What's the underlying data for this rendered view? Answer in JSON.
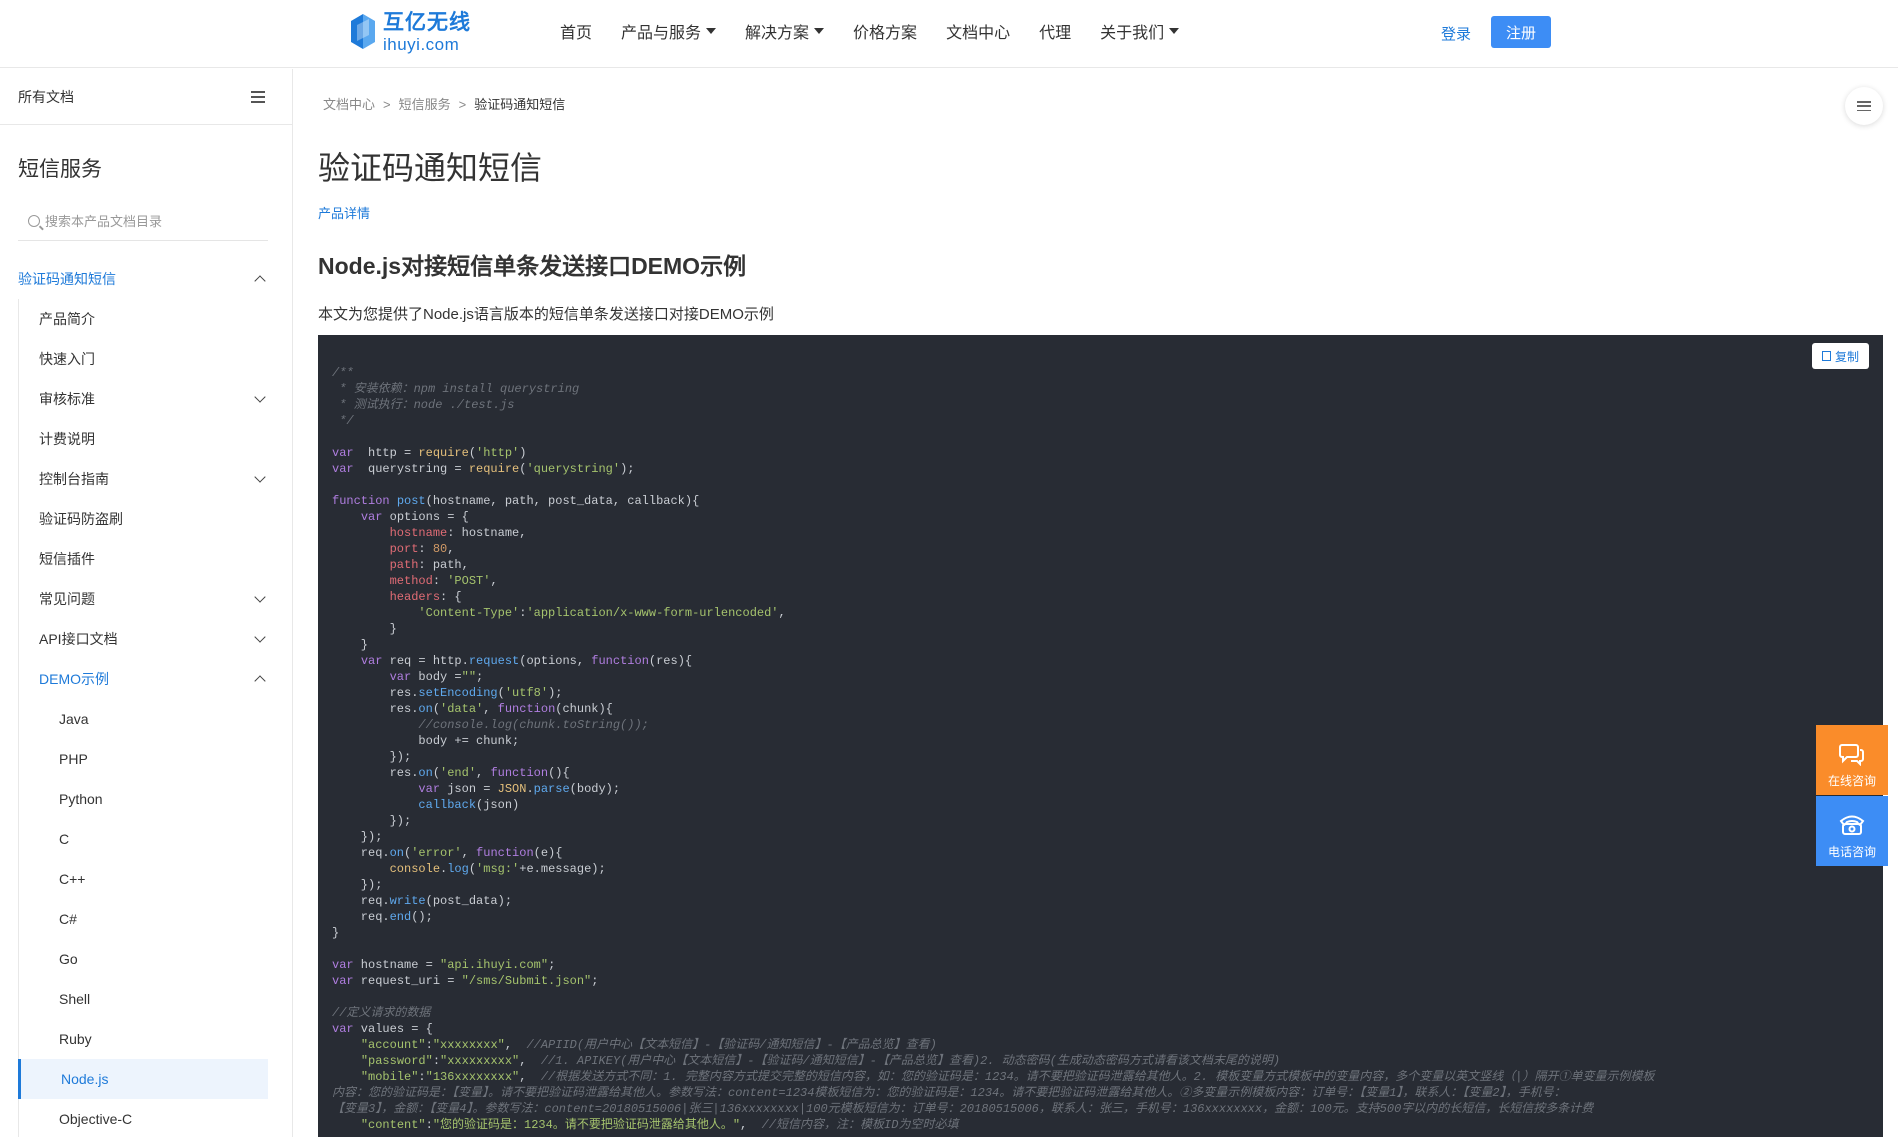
{
  "header": {
    "logo_cn": "互亿无线",
    "logo_en": "ihuyi.com",
    "nav": [
      {
        "label": "首页",
        "dropdown": false
      },
      {
        "label": "产品与服务",
        "dropdown": true
      },
      {
        "label": "解决方案",
        "dropdown": true
      },
      {
        "label": "价格方案",
        "dropdown": false
      },
      {
        "label": "文档中心",
        "dropdown": false
      },
      {
        "label": "代理",
        "dropdown": false
      },
      {
        "label": "关于我们",
        "dropdown": true
      }
    ],
    "login": "登录",
    "register": "注册"
  },
  "sidebar": {
    "all_docs": "所有文档",
    "product_title": "短信服务",
    "search_placeholder": "搜索本产品文档目录",
    "items": [
      {
        "label": "验证码通知短信",
        "level": 0,
        "chevron": "up",
        "active": true
      },
      {
        "label": "产品简介",
        "level": 1
      },
      {
        "label": "快速入门",
        "level": 1
      },
      {
        "label": "审核标准",
        "level": 1,
        "chevron": "down"
      },
      {
        "label": "计费说明",
        "level": 1
      },
      {
        "label": "控制台指南",
        "level": 1,
        "chevron": "down"
      },
      {
        "label": "验证码防盗刷",
        "level": 1
      },
      {
        "label": "短信插件",
        "level": 1
      },
      {
        "label": "常见问题",
        "level": 1,
        "chevron": "down"
      },
      {
        "label": "API接口文档",
        "level": 1,
        "chevron": "down"
      },
      {
        "label": "DEMO示例",
        "level": 1,
        "chevron": "up",
        "active": true
      },
      {
        "label": "Java",
        "level": 2
      },
      {
        "label": "PHP",
        "level": 2
      },
      {
        "label": "Python",
        "level": 2
      },
      {
        "label": "C",
        "level": 2
      },
      {
        "label": "C++",
        "level": 2
      },
      {
        "label": "C#",
        "level": 2
      },
      {
        "label": "Go",
        "level": 2
      },
      {
        "label": "Shell",
        "level": 2
      },
      {
        "label": "Ruby",
        "level": 2
      },
      {
        "label": "Node.js",
        "level": 2,
        "selected": true
      },
      {
        "label": "Objective-C",
        "level": 2
      }
    ]
  },
  "main": {
    "breadcrumb": [
      "文档中心",
      "短信服务",
      "验证码通知短信"
    ],
    "breadcrumb_sep": ">",
    "page_title": "验证码通知短信",
    "product_detail": "产品详情",
    "section_title": "Node.js对接短信单条发送接口DEMO示例",
    "intro": "本文为您提供了Node.js语言版本的短信单条发送接口对接DEMO示例",
    "copy_label": "复制",
    "code_lines": [
      [
        [
          "c-com",
          "/**"
        ]
      ],
      [
        [
          "c-com",
          " * 安装依赖：npm install querystring"
        ]
      ],
      [
        [
          "c-com",
          " * 测试执行：node ./test.js"
        ]
      ],
      [
        [
          "c-com",
          " */"
        ]
      ],
      [],
      [
        [
          "c-kw",
          "var"
        ],
        [
          "",
          "  http = "
        ],
        [
          "c-obj",
          "require"
        ],
        [
          "",
          "("
        ],
        [
          "c-str",
          "'http'"
        ],
        [
          "",
          ")"
        ]
      ],
      [
        [
          "c-kw",
          "var"
        ],
        [
          "",
          "  querystring = "
        ],
        [
          "c-obj",
          "require"
        ],
        [
          "",
          "("
        ],
        [
          "c-str",
          "'querystring'"
        ],
        [
          "",
          ");"
        ]
      ],
      [],
      [
        [
          "c-kw",
          "function"
        ],
        [
          "",
          " "
        ],
        [
          "c-fn",
          "post"
        ],
        [
          "",
          "(hostname, path, post_data, callback){"
        ]
      ],
      [
        [
          "",
          "    "
        ],
        [
          "c-kw",
          "var"
        ],
        [
          "",
          " options = {"
        ]
      ],
      [
        [
          "",
          "        "
        ],
        [
          "c-prop",
          "hostname"
        ],
        [
          "",
          ": hostname,"
        ]
      ],
      [
        [
          "",
          "        "
        ],
        [
          "c-prop",
          "port"
        ],
        [
          "",
          ": "
        ],
        [
          "c-num",
          "80"
        ],
        [
          "",
          ","
        ]
      ],
      [
        [
          "",
          "        "
        ],
        [
          "c-prop",
          "path"
        ],
        [
          "",
          ": path,"
        ]
      ],
      [
        [
          "",
          "        "
        ],
        [
          "c-prop",
          "method"
        ],
        [
          "",
          ": "
        ],
        [
          "c-str",
          "'POST'"
        ],
        [
          "",
          ","
        ]
      ],
      [
        [
          "",
          "        "
        ],
        [
          "c-prop",
          "headers"
        ],
        [
          "",
          ": {"
        ]
      ],
      [
        [
          "",
          "            "
        ],
        [
          "c-str",
          "'Content-Type'"
        ],
        [
          "",
          ":"
        ],
        [
          "c-str",
          "'application/x-www-form-urlencoded'"
        ],
        [
          "",
          ","
        ]
      ],
      [
        [
          "",
          "        }"
        ]
      ],
      [
        [
          "",
          "    }"
        ]
      ],
      [
        [
          "",
          "    "
        ],
        [
          "c-kw",
          "var"
        ],
        [
          "",
          " req = http."
        ],
        [
          "c-fn",
          "request"
        ],
        [
          "",
          "(options, "
        ],
        [
          "c-kw",
          "function"
        ],
        [
          "",
          "(res){"
        ]
      ],
      [
        [
          "",
          "        "
        ],
        [
          "c-kw",
          "var"
        ],
        [
          "",
          " body ="
        ],
        [
          "c-str",
          "\"\""
        ],
        [
          "",
          ";"
        ]
      ],
      [
        [
          "",
          "        res."
        ],
        [
          "c-fn",
          "setEncoding"
        ],
        [
          "",
          "("
        ],
        [
          "c-str",
          "'utf8'"
        ],
        [
          "",
          ");"
        ]
      ],
      [
        [
          "",
          "        res."
        ],
        [
          "c-fn",
          "on"
        ],
        [
          "",
          "("
        ],
        [
          "c-str",
          "'data'"
        ],
        [
          "",
          ", "
        ],
        [
          "c-kw",
          "function"
        ],
        [
          "",
          "(chunk){"
        ]
      ],
      [
        [
          "",
          "            "
        ],
        [
          "c-com",
          "//console.log(chunk.toString());"
        ]
      ],
      [
        [
          "",
          "            body += chunk;"
        ]
      ],
      [
        [
          "",
          "        });"
        ]
      ],
      [
        [
          "",
          "        res."
        ],
        [
          "c-fn",
          "on"
        ],
        [
          "",
          "("
        ],
        [
          "c-str",
          "'end'"
        ],
        [
          "",
          ", "
        ],
        [
          "c-kw",
          "function"
        ],
        [
          "",
          "(){"
        ]
      ],
      [
        [
          "",
          "            "
        ],
        [
          "c-kw",
          "var"
        ],
        [
          "",
          " json = "
        ],
        [
          "c-obj",
          "JSON"
        ],
        [
          "",
          "."
        ],
        [
          "c-fn",
          "parse"
        ],
        [
          "",
          "(body);"
        ]
      ],
      [
        [
          "",
          "            "
        ],
        [
          "c-fn",
          "callback"
        ],
        [
          "",
          "(json)"
        ]
      ],
      [
        [
          "",
          "        });"
        ]
      ],
      [
        [
          "",
          "    });"
        ]
      ],
      [
        [
          "",
          "    req."
        ],
        [
          "c-fn",
          "on"
        ],
        [
          "",
          "("
        ],
        [
          "c-str",
          "'error'"
        ],
        [
          "",
          ", "
        ],
        [
          "c-kw",
          "function"
        ],
        [
          "",
          "(e){"
        ]
      ],
      [
        [
          "",
          "        "
        ],
        [
          "c-obj",
          "console"
        ],
        [
          "",
          "."
        ],
        [
          "c-fn",
          "log"
        ],
        [
          "",
          "("
        ],
        [
          "c-str",
          "'msg:'"
        ],
        [
          "",
          "+e.message);"
        ]
      ],
      [
        [
          "",
          "    });"
        ]
      ],
      [
        [
          "",
          "    req."
        ],
        [
          "c-fn",
          "write"
        ],
        [
          "",
          "(post_data);"
        ]
      ],
      [
        [
          "",
          "    req."
        ],
        [
          "c-fn",
          "end"
        ],
        [
          "",
          "();"
        ]
      ],
      [
        [
          "",
          "}"
        ]
      ],
      [],
      [
        [
          "c-kw",
          "var"
        ],
        [
          "",
          " hostname = "
        ],
        [
          "c-str",
          "\"api.ihuyi.com\""
        ],
        [
          "",
          ";"
        ]
      ],
      [
        [
          "c-kw",
          "var"
        ],
        [
          "",
          " request_uri = "
        ],
        [
          "c-str",
          "\"/sms/Submit.json\""
        ],
        [
          "",
          ";"
        ]
      ],
      [],
      [
        [
          "c-com",
          "//定义请求的数据"
        ]
      ],
      [
        [
          "c-kw",
          "var"
        ],
        [
          "",
          " values = {"
        ]
      ],
      [
        [
          "",
          "    "
        ],
        [
          "c-str",
          "\"account\""
        ],
        [
          "",
          ":"
        ],
        [
          "c-str",
          "\"xxxxxxxx\""
        ],
        [
          "",
          ",  "
        ],
        [
          "c-com",
          "//APIID(用户中心【文本短信】-【验证码/通知短信】-【产品总览】查看)"
        ]
      ],
      [
        [
          "",
          "    "
        ],
        [
          "c-str",
          "\"password\""
        ],
        [
          "",
          ":"
        ],
        [
          "c-str",
          "\"xxxxxxxxx\""
        ],
        [
          "",
          ",  "
        ],
        [
          "c-com",
          "//1. APIKEY(用户中心【文本短信】-【验证码/通知短信】-【产品总览】查看)2. 动态密码(生成动态密码方式请看该文档末尾的说明)"
        ]
      ],
      [
        [
          "",
          "    "
        ],
        [
          "c-str",
          "\"mobile\""
        ],
        [
          "",
          ":"
        ],
        [
          "c-str",
          "\"136xxxxxxxx\""
        ],
        [
          "",
          ",  "
        ],
        [
          "c-com",
          "//根据发送方式不同：1. 完整内容方式提交完整的短信内容，如：您的验证码是：1234。请不要把验证码泄露给其他人。2. 模板变量方式模板中的变量内容，多个变量以英文竖线（|）隔开①单变量示例模板"
        ]
      ],
      [
        [
          "c-com",
          "内容：您的验证码是：【变量】。请不要把验证码泄露给其他人。参数写法：content=1234模板短信为：您的验证码是：1234。请不要把验证码泄露给其他人。②多变量示例模板内容：订单号：【变量1】，联系人：【变量2】，手机号："
        ]
      ],
      [
        [
          "c-com",
          "【变量3】，金额：【变量4】。参数写法：content=20180515006|张三|136xxxxxxxx|100元模板短信为：订单号：20180515006，联系人：张三，手机号：136xxxxxxxx，金额：100元。支持500字以内的长短信，长短信按多条计费"
        ]
      ],
      [
        [
          "",
          "    "
        ],
        [
          "c-str",
          "\"content\""
        ],
        [
          "",
          ":"
        ],
        [
          "c-str",
          "\"您的验证码是：1234。请不要把验证码泄露给其他人。\""
        ],
        [
          "",
          ",  "
        ],
        [
          "c-com",
          "//短信内容，注：模板ID为空时必填"
        ]
      ]
    ]
  },
  "toc_label": "目录",
  "float": {
    "chat": "在线咨询",
    "phone": "电话咨询"
  },
  "colors": {
    "brand": "#1e7ad9",
    "register_bg": "#3d8df5",
    "chat_bg": "#fa8c2a",
    "phone_bg": "#3d8df5",
    "code_bg": "#282c34"
  }
}
